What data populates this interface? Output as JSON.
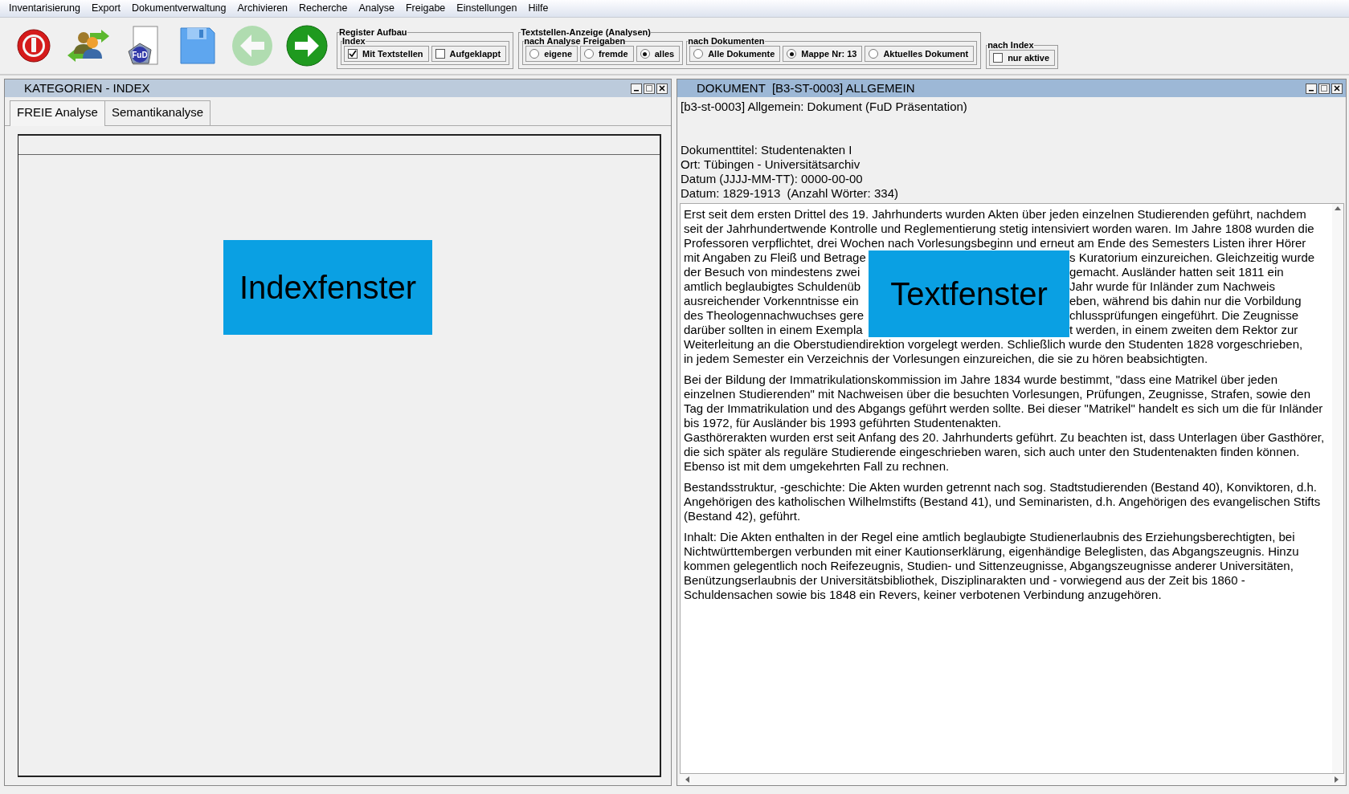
{
  "menu": [
    {
      "label": "Inventarisierung"
    },
    {
      "label": "Export"
    },
    {
      "label": "Dokumentverwaltung"
    },
    {
      "label": "Archivieren"
    },
    {
      "label": "Recherche"
    },
    {
      "label": "Analyse"
    },
    {
      "label": "Freigabe"
    },
    {
      "label": "Einstellungen"
    },
    {
      "label": "Hilfe"
    }
  ],
  "toolbar": {
    "buttons": [
      {
        "kind": "power"
      },
      {
        "kind": "users"
      },
      {
        "kind": "document",
        "badge": "FuD"
      },
      {
        "kind": "save"
      },
      {
        "kind": "back",
        "disabled": true
      },
      {
        "kind": "forward",
        "disabled": false
      }
    ],
    "groups": [
      {
        "title": "Register Aufbau",
        "subgroups": [
          {
            "title": "Index",
            "options": [
              {
                "kind": "checkbox",
                "label": "Mit Textstellen",
                "checked": true
              },
              {
                "kind": "checkbox",
                "label": "Aufgeklappt",
                "checked": false
              }
            ]
          }
        ]
      },
      {
        "title": "Textstellen-Anzeige (Analysen)",
        "subgroups": [
          {
            "title": "nach Analyse Freigaben",
            "options": [
              {
                "kind": "radio",
                "label": "eigene",
                "selected": false
              },
              {
                "kind": "radio",
                "label": "fremde",
                "selected": false
              },
              {
                "kind": "radio",
                "label": "alles",
                "selected": true
              }
            ]
          },
          {
            "title": "nach Dokumenten",
            "options": [
              {
                "kind": "radio",
                "label": "Alle Dokumente",
                "selected": false
              },
              {
                "kind": "radio",
                "label": "Mappe Nr: 13",
                "selected": true
              },
              {
                "kind": "radio",
                "label": "Aktuelles Dokument",
                "selected": false
              }
            ]
          }
        ]
      },
      {
        "title": "nach Index",
        "options": [
          {
            "kind": "checkbox",
            "label": "nur aktive",
            "checked": false
          }
        ]
      }
    ]
  },
  "index_panel": {
    "title": "KATEGORIEN - INDEX",
    "tabs": [
      {
        "label": "FREIE Analyse",
        "selected": true
      },
      {
        "label": "Semantikanalyse",
        "selected": false
      }
    ],
    "overlay_label": "Indexfenster"
  },
  "document_panel": {
    "title": "DOKUMENT  [B3-ST-0003] ALLGEMEIN",
    "header": "[b3-st-0003] Allgemein: Dokument (FuD Präsentation)",
    "meta": [
      "Dokumenttitel: Studentenakten I",
      "Ort: Tübingen - Universitätsarchiv",
      "Datum (JJJJ-MM-TT): 0000-00-00",
      "Datum: 1829-1913  (Anzahl Wörter: 334)"
    ],
    "overlay_label": "Textfenster",
    "paragraphs": [
      {
        "kind": "split",
        "lines": [
          {
            "text": "Erst seit dem ersten Drittel des 19. Jahrhunderts wurden Akten über jeden einzelnen Studierenden geführt, nachdem"
          },
          {
            "text": "seit der Jahrhundertwende Kontrolle und Reglementierung stetig intensiviert worden waren. Im Jahre 1808 wurden die"
          },
          {
            "text": "Professoren verpflichtet, drei Wochen nach Vorlesungsbeginn und erneut am Ende des Semesters Listen ihrer Hörer"
          },
          {
            "left": "mit Angaben zu Fleiß und Betrage",
            "right": "s Kuratorium einzureichen. Gleichzeitig wurde"
          },
          {
            "left": "der Besuch von mindestens zwei",
            "right": "gemacht. Ausländer hatten seit 1811 ein"
          },
          {
            "left": "amtlich beglaubigtes Schuldenüb",
            "right": "Jahr wurde für Inländer zum Nachweis"
          },
          {
            "left": "ausreichender Vorkenntnisse ein",
            "right": "eben, während bis dahin nur die Vorbildung"
          },
          {
            "left": "des Theologennachwuchses gere",
            "right": "chlussprüfungen eingeführt. Die Zeugnisse"
          },
          {
            "left": "darüber sollten in einem Exempla",
            "right": "t werden, in einem zweiten dem Rektor zur"
          },
          {
            "text": "Weiterleitung an die Oberstudiendirektion vorgelegt werden. Schließlich wurde den Studenten 1828 vorgeschrieben,"
          },
          {
            "text": "in jedem Semester ein Verzeichnis der Vorlesungen einzureichen, die sie zu hören beabsichtigten."
          }
        ]
      },
      {
        "kind": "plain",
        "text": "Bei der Bildung der Immatrikulationskommission im Jahre 1834 wurde bestimmt, \"dass eine Matrikel über jeden einzelnen Studierenden\" mit Nachweisen über die besuchten Vorlesungen, Prüfungen, Zeugnisse, Strafen, sowie den Tag der Immatrikulation und des Abgangs geführt werden sollte. Bei dieser \"Matrikel\" handelt es sich um die für Inländer bis 1972, für Ausländer bis 1993 geführten Studentenakten.\nGasthörerakten wurden erst seit Anfang des 20. Jahrhunderts geführt. Zu beachten ist, dass Unterlagen über Gasthörer, die sich später als reguläre Studierende eingeschrieben waren, sich auch unter den Studentenakten finden können. Ebenso ist mit dem umgekehrten Fall zu rechnen."
      },
      {
        "kind": "plain",
        "text": "Bestandsstruktur, -geschichte: Die Akten wurden getrennt nach sog. Stadtstudierenden (Bestand 40), Konviktoren, d.h. Angehörigen des katholischen Wilhelmstifts (Bestand 41), und Seminaristen, d.h. Angehörigen des evangelischen Stifts (Bestand 42), geführt."
      },
      {
        "kind": "plain",
        "text": "Inhalt: Die Akten enthalten in der Regel eine amtlich beglaubigte Studienerlaubnis des Erziehungsberechtigten, bei Nichtwürttembergen verbunden mit einer Kautionserklärung, eigenhändige Beleglisten, das Abgangszeugnis. Hinzu kommen gelegentlich noch Reifezeugnis, Studien- und Sittenzeugnisse, Abgangszeugnisse anderer Universitäten, Benützungserlaubnis der Universitätsbibliothek, Disziplinarakten und - vorwiegend aus der Zeit bis 1860 - Schuldensachen sowie bis 1848 ein Revers, keiner verbotenen Verbindung anzugehören."
      }
    ]
  }
}
